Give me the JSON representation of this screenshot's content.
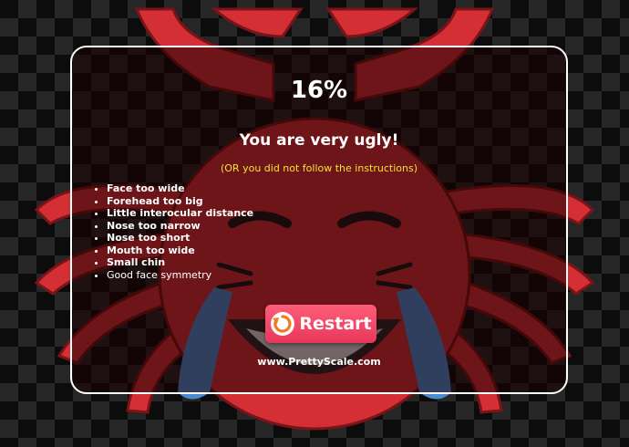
{
  "result": {
    "score": "16%",
    "verdict": "You are very ugly!",
    "note": "(OR you did not follow the instructions)"
  },
  "issues": [
    {
      "text": "Face too wide",
      "bold": true
    },
    {
      "text": "Forehead too big",
      "bold": true
    },
    {
      "text": "Little interocular distance",
      "bold": true
    },
    {
      "text": "Nose too narrow",
      "bold": true
    },
    {
      "text": "Nose too short",
      "bold": true
    },
    {
      "text": "Mouth too wide",
      "bold": true
    },
    {
      "text": "Small chin",
      "bold": true
    },
    {
      "text": "Good face symmetry",
      "bold": false
    }
  ],
  "actions": {
    "restart_label": "Restart",
    "restart_icon": "restart-icon"
  },
  "footer": {
    "site": "www.PrettyScale.com"
  },
  "colors": {
    "crab": "#d32f35",
    "note": "#f2e23a",
    "button": "#f04a68",
    "tears": "#4a8ccf"
  }
}
